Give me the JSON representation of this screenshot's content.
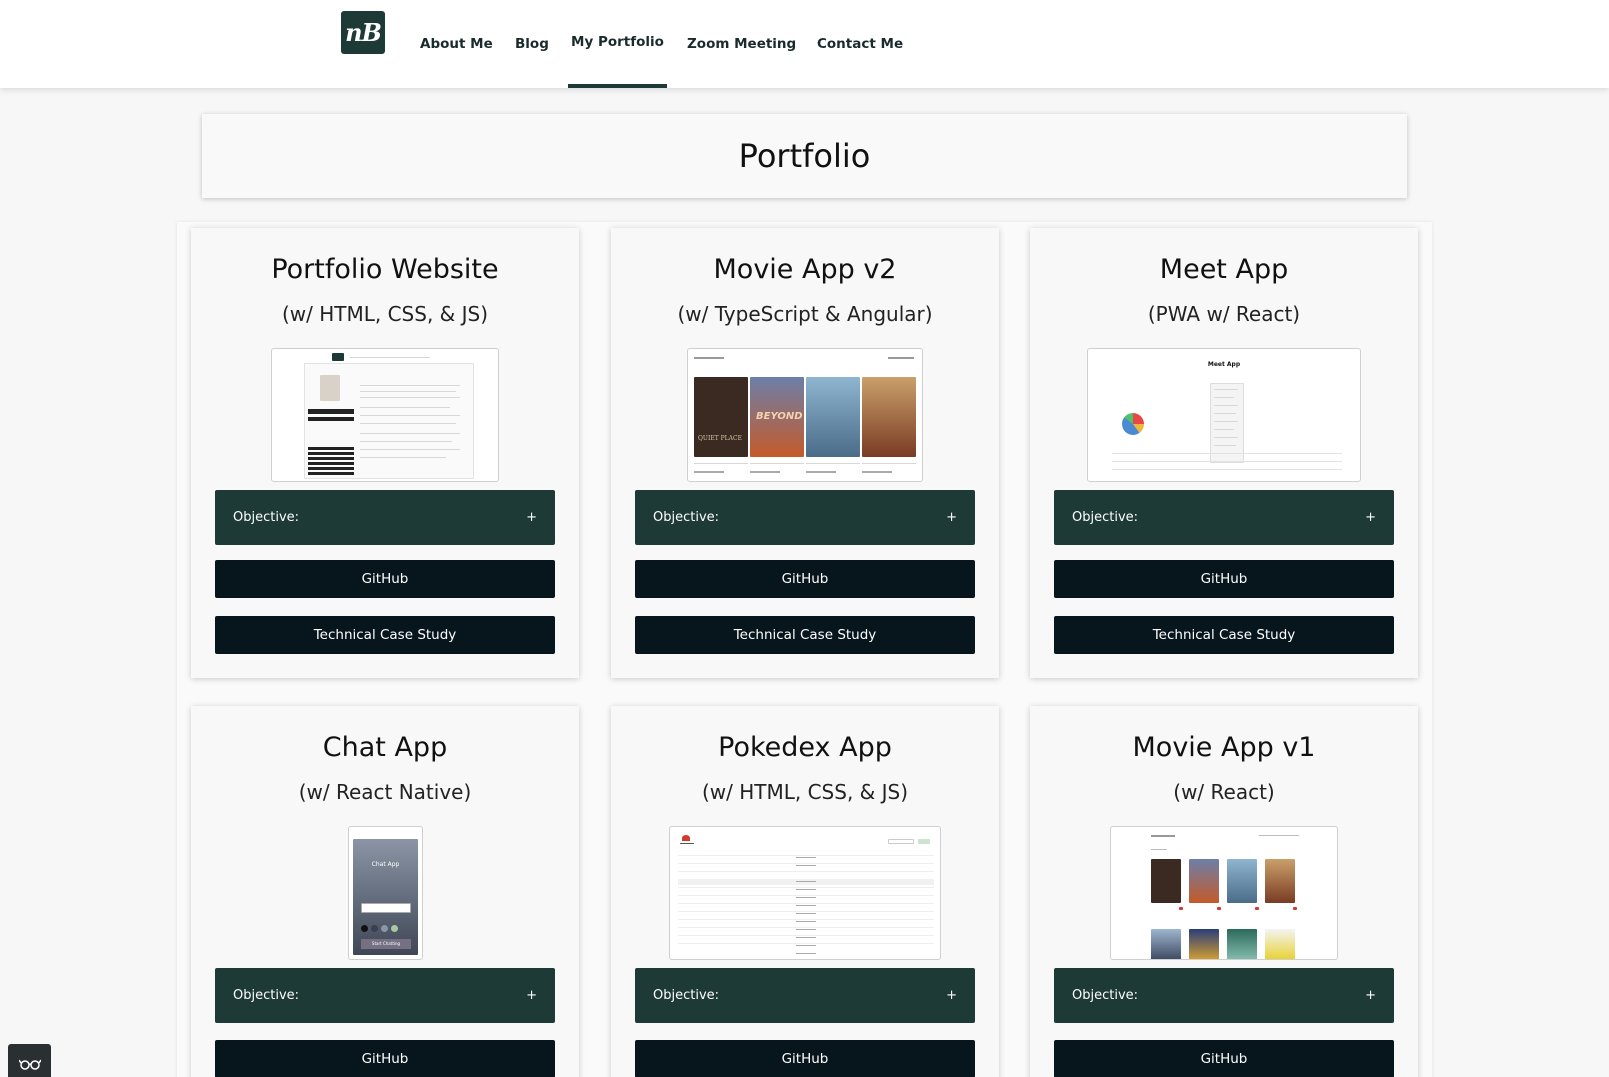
{
  "header": {
    "logo_text": "nB",
    "nav": [
      {
        "label": "About Me",
        "active": false
      },
      {
        "label": "Blog",
        "active": false
      },
      {
        "label": "My Portfolio",
        "active": true
      },
      {
        "label": "Zoom Meeting",
        "active": false
      },
      {
        "label": "Contact Me",
        "active": false
      }
    ]
  },
  "page": {
    "title": "Portfolio"
  },
  "colors": {
    "accent": "#1e3a36",
    "button": "#07151c",
    "background": "#f7f7f7"
  },
  "projects": [
    {
      "title": "Portfolio Website",
      "subtitle": "(w/ HTML, CSS, & JS)",
      "objective_label": "Objective:",
      "toggle": "+",
      "github_label": "GitHub",
      "case_study_label": "Technical Case Study"
    },
    {
      "title": "Movie App v2",
      "subtitle": "(w/ TypeScript & Angular)",
      "objective_label": "Objective:",
      "toggle": "+",
      "github_label": "GitHub",
      "case_study_label": "Technical Case Study"
    },
    {
      "title": "Meet App",
      "subtitle": "(PWA w/ React)",
      "objective_label": "Objective:",
      "toggle": "+",
      "github_label": "GitHub",
      "case_study_label": "Technical Case Study"
    },
    {
      "title": "Chat App",
      "subtitle": "(w/ React Native)",
      "objective_label": "Objective:",
      "toggle": "+",
      "github_label": "GitHub"
    },
    {
      "title": "Pokedex App",
      "subtitle": "(w/ HTML, CSS, & JS)",
      "objective_label": "Objective:",
      "toggle": "+",
      "github_label": "GitHub"
    },
    {
      "title": "Movie App v1",
      "subtitle": "(w/ React)",
      "objective_label": "Objective:",
      "toggle": "+",
      "github_label": "GitHub"
    }
  ],
  "thumb_text": {
    "chat_title": "Chat App",
    "chat_button": "Start Chatting",
    "meet_title": "Meet App",
    "quiet_place": "QUIET PLACE",
    "beyond": "BEYOND"
  },
  "widget": {
    "icon": "glasses-icon"
  }
}
